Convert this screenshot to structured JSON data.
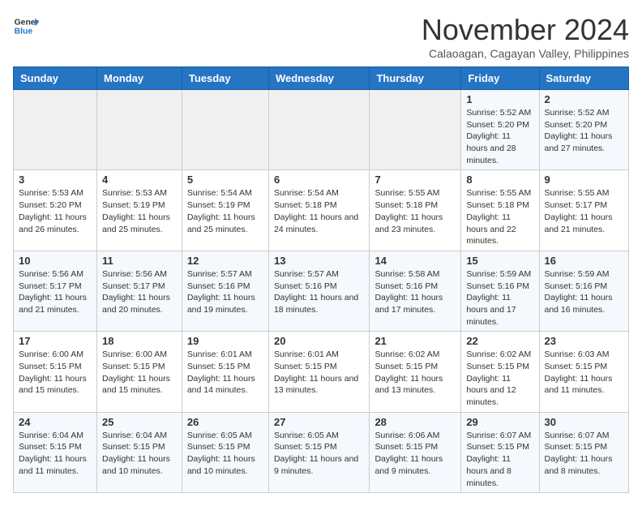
{
  "logo": {
    "line1": "General",
    "line2": "Blue"
  },
  "title": "November 2024",
  "location": "Calaoagan, Cagayan Valley, Philippines",
  "days_of_week": [
    "Sunday",
    "Monday",
    "Tuesday",
    "Wednesday",
    "Thursday",
    "Friday",
    "Saturday"
  ],
  "weeks": [
    [
      {
        "day": "",
        "info": ""
      },
      {
        "day": "",
        "info": ""
      },
      {
        "day": "",
        "info": ""
      },
      {
        "day": "",
        "info": ""
      },
      {
        "day": "",
        "info": ""
      },
      {
        "day": "1",
        "info": "Sunrise: 5:52 AM\nSunset: 5:20 PM\nDaylight: 11 hours\nand 28 minutes."
      },
      {
        "day": "2",
        "info": "Sunrise: 5:52 AM\nSunset: 5:20 PM\nDaylight: 11 hours\nand 27 minutes."
      }
    ],
    [
      {
        "day": "3",
        "info": "Sunrise: 5:53 AM\nSunset: 5:20 PM\nDaylight: 11 hours\nand 26 minutes."
      },
      {
        "day": "4",
        "info": "Sunrise: 5:53 AM\nSunset: 5:19 PM\nDaylight: 11 hours\nand 25 minutes."
      },
      {
        "day": "5",
        "info": "Sunrise: 5:54 AM\nSunset: 5:19 PM\nDaylight: 11 hours\nand 25 minutes."
      },
      {
        "day": "6",
        "info": "Sunrise: 5:54 AM\nSunset: 5:18 PM\nDaylight: 11 hours\nand 24 minutes."
      },
      {
        "day": "7",
        "info": "Sunrise: 5:55 AM\nSunset: 5:18 PM\nDaylight: 11 hours\nand 23 minutes."
      },
      {
        "day": "8",
        "info": "Sunrise: 5:55 AM\nSunset: 5:18 PM\nDaylight: 11 hours\nand 22 minutes."
      },
      {
        "day": "9",
        "info": "Sunrise: 5:55 AM\nSunset: 5:17 PM\nDaylight: 11 hours\nand 21 minutes."
      }
    ],
    [
      {
        "day": "10",
        "info": "Sunrise: 5:56 AM\nSunset: 5:17 PM\nDaylight: 11 hours\nand 21 minutes."
      },
      {
        "day": "11",
        "info": "Sunrise: 5:56 AM\nSunset: 5:17 PM\nDaylight: 11 hours\nand 20 minutes."
      },
      {
        "day": "12",
        "info": "Sunrise: 5:57 AM\nSunset: 5:16 PM\nDaylight: 11 hours\nand 19 minutes."
      },
      {
        "day": "13",
        "info": "Sunrise: 5:57 AM\nSunset: 5:16 PM\nDaylight: 11 hours\nand 18 minutes."
      },
      {
        "day": "14",
        "info": "Sunrise: 5:58 AM\nSunset: 5:16 PM\nDaylight: 11 hours\nand 17 minutes."
      },
      {
        "day": "15",
        "info": "Sunrise: 5:59 AM\nSunset: 5:16 PM\nDaylight: 11 hours\nand 17 minutes."
      },
      {
        "day": "16",
        "info": "Sunrise: 5:59 AM\nSunset: 5:16 PM\nDaylight: 11 hours\nand 16 minutes."
      }
    ],
    [
      {
        "day": "17",
        "info": "Sunrise: 6:00 AM\nSunset: 5:15 PM\nDaylight: 11 hours\nand 15 minutes."
      },
      {
        "day": "18",
        "info": "Sunrise: 6:00 AM\nSunset: 5:15 PM\nDaylight: 11 hours\nand 15 minutes."
      },
      {
        "day": "19",
        "info": "Sunrise: 6:01 AM\nSunset: 5:15 PM\nDaylight: 11 hours\nand 14 minutes."
      },
      {
        "day": "20",
        "info": "Sunrise: 6:01 AM\nSunset: 5:15 PM\nDaylight: 11 hours\nand 13 minutes."
      },
      {
        "day": "21",
        "info": "Sunrise: 6:02 AM\nSunset: 5:15 PM\nDaylight: 11 hours\nand 13 minutes."
      },
      {
        "day": "22",
        "info": "Sunrise: 6:02 AM\nSunset: 5:15 PM\nDaylight: 11 hours\nand 12 minutes."
      },
      {
        "day": "23",
        "info": "Sunrise: 6:03 AM\nSunset: 5:15 PM\nDaylight: 11 hours\nand 11 minutes."
      }
    ],
    [
      {
        "day": "24",
        "info": "Sunrise: 6:04 AM\nSunset: 5:15 PM\nDaylight: 11 hours\nand 11 minutes."
      },
      {
        "day": "25",
        "info": "Sunrise: 6:04 AM\nSunset: 5:15 PM\nDaylight: 11 hours\nand 10 minutes."
      },
      {
        "day": "26",
        "info": "Sunrise: 6:05 AM\nSunset: 5:15 PM\nDaylight: 11 hours\nand 10 minutes."
      },
      {
        "day": "27",
        "info": "Sunrise: 6:05 AM\nSunset: 5:15 PM\nDaylight: 11 hours\nand 9 minutes."
      },
      {
        "day": "28",
        "info": "Sunrise: 6:06 AM\nSunset: 5:15 PM\nDaylight: 11 hours\nand 9 minutes."
      },
      {
        "day": "29",
        "info": "Sunrise: 6:07 AM\nSunset: 5:15 PM\nDaylight: 11 hours\nand 8 minutes."
      },
      {
        "day": "30",
        "info": "Sunrise: 6:07 AM\nSunset: 5:15 PM\nDaylight: 11 hours\nand 8 minutes."
      }
    ]
  ]
}
